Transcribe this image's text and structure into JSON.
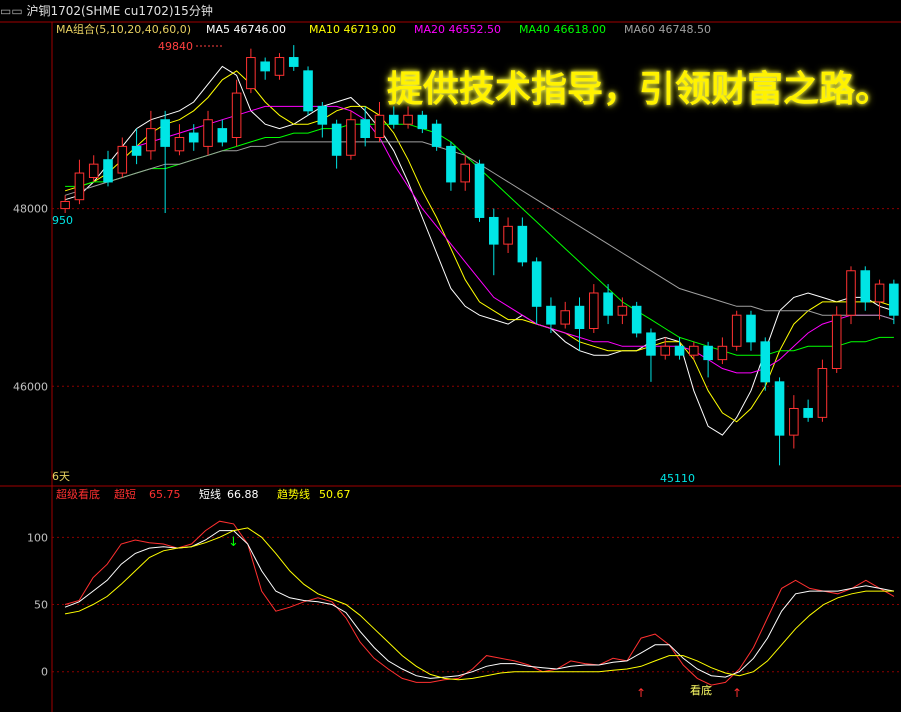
{
  "header": {
    "title": "沪铜1702(SHME  cu1702)15分钟",
    "ma_legend": [
      {
        "label": "MA组合(5,10,20,40,60,0)",
        "color": "#e8d060"
      },
      {
        "label": "MA5  46746.00",
        "color": "#ffffff"
      },
      {
        "label": "MA10  46719.00",
        "color": "#ffff00"
      },
      {
        "label": "MA20  46552.50",
        "color": "#ff00ff"
      },
      {
        "label": "MA40  46618.00",
        "color": "#00ff00"
      },
      {
        "label": "MA60  46748.50",
        "color": "#a0a0a0"
      }
    ]
  },
  "slogan": "提供技术指导，引领财富之路。",
  "price_axis": {
    "ticks": [
      "48000",
      "46000"
    ]
  },
  "price_annotations": {
    "high": "49840",
    "low": "45110",
    "left_price": "950",
    "left_days": "6天"
  },
  "indicator": {
    "legend": [
      {
        "label": "超级看底",
        "color": "#ff3030"
      },
      {
        "label": "超短",
        "color": "#ff3030"
      },
      {
        "label": "65.75",
        "color": "#ff3030"
      },
      {
        "label": "短线",
        "color": "#ffffff"
      },
      {
        "label": "66.88",
        "color": "#ffffff"
      },
      {
        "label": "趋势线",
        "color": "#ffff00"
      },
      {
        "label": "50.67",
        "color": "#ffff00"
      }
    ],
    "axis_ticks": [
      "100",
      "50",
      "0"
    ],
    "signal_label": "看底"
  },
  "chart_data": [
    {
      "type": "line",
      "title": "沪铜1702 15分钟",
      "ylim": [
        44900,
        50100
      ],
      "series": [
        {
          "name": "MA5",
          "color": "#ffffff",
          "values": [
            48100,
            48150,
            48300,
            48500,
            48700,
            48900,
            49000,
            49050,
            49100,
            49200,
            49400,
            49600,
            49500,
            49100,
            48950,
            48900,
            48950,
            49050,
            49150,
            49200,
            49250,
            49100,
            48900,
            48650,
            48300,
            47900,
            47500,
            47100,
            46900,
            46800,
            46750,
            46700,
            46800,
            46700,
            46650,
            46500,
            46400,
            46350,
            46350,
            46400,
            46400,
            46500,
            46550,
            46500,
            45950,
            45550,
            45450,
            45650,
            45950,
            46400,
            46850,
            47000,
            47050,
            47000,
            46950,
            47000,
            47000,
            46900,
            46850
          ]
        },
        {
          "name": "MA10",
          "color": "#ffff00",
          "values": [
            48200,
            48250,
            48300,
            48400,
            48550,
            48700,
            48850,
            48950,
            49000,
            49100,
            49250,
            49450,
            49550,
            49400,
            49200,
            49050,
            48950,
            48950,
            49000,
            49100,
            49150,
            49150,
            49050,
            48850,
            48550,
            48200,
            47900,
            47550,
            47200,
            46950,
            46850,
            46750,
            46750,
            46700,
            46650,
            46600,
            46500,
            46450,
            46400,
            46400,
            46400,
            46450,
            46500,
            46500,
            46300,
            45950,
            45700,
            45600,
            45750,
            46000,
            46400,
            46700,
            46850,
            46950,
            46950,
            46950,
            46950,
            46950,
            46900
          ]
        },
        {
          "name": "MA20",
          "color": "#ff00ff",
          "values": [
            null,
            null,
            null,
            null,
            null,
            48700,
            48750,
            48800,
            48850,
            48900,
            48950,
            49000,
            49050,
            49100,
            49150,
            49150,
            49150,
            49150,
            49150,
            49150,
            49100,
            49000,
            48800,
            48500,
            48250,
            48000,
            47800,
            47600,
            47400,
            47200,
            47000,
            46900,
            46800,
            46700,
            46650,
            46600,
            46550,
            46500,
            46500,
            46450,
            46450,
            46450,
            46450,
            46450,
            46400,
            46300,
            46200,
            46150,
            46150,
            46200,
            46300,
            46450,
            46600,
            46700,
            46750,
            46800,
            46800,
            46800,
            46750
          ]
        },
        {
          "name": "MA40",
          "color": "#00ff00",
          "values": [
            48250,
            48250,
            48300,
            48300,
            48350,
            48400,
            48450,
            48450,
            48500,
            48550,
            48600,
            48650,
            48700,
            48750,
            48800,
            48800,
            48850,
            48850,
            48900,
            48900,
            48950,
            48950,
            48950,
            48950,
            48950,
            48900,
            48850,
            48750,
            48600,
            48450,
            48300,
            48150,
            48000,
            47850,
            47700,
            47550,
            47400,
            47250,
            47100,
            46950,
            46850,
            46750,
            46650,
            46550,
            46500,
            46450,
            46400,
            46350,
            46350,
            46350,
            46400,
            46400,
            46450,
            46450,
            46450,
            46500,
            46500,
            46550,
            46550
          ]
        },
        {
          "name": "MA60",
          "color": "#a0a0a0",
          "values": [
            48150,
            48200,
            48250,
            48300,
            48350,
            48400,
            48450,
            48500,
            48500,
            48550,
            48600,
            48650,
            48650,
            48700,
            48700,
            48750,
            48750,
            48750,
            48750,
            48750,
            48750,
            48750,
            48750,
            48750,
            48750,
            48750,
            48700,
            48650,
            48600,
            48500,
            48400,
            48300,
            48200,
            48100,
            48000,
            47900,
            47800,
            47700,
            47600,
            47500,
            47400,
            47300,
            47200,
            47100,
            47050,
            47000,
            46950,
            46900,
            46900,
            46850,
            46850,
            46850,
            46850,
            46800,
            46800,
            46800,
            46800,
            46800,
            46750
          ]
        }
      ],
      "candles": [
        {
          "o": 48000,
          "c": 48080,
          "h": 48150,
          "l": 47950
        },
        {
          "o": 48100,
          "c": 48400,
          "h": 48550,
          "l": 48050
        },
        {
          "o": 48350,
          "c": 48500,
          "h": 48600,
          "l": 48300
        },
        {
          "o": 48550,
          "c": 48300,
          "h": 48650,
          "l": 48250
        },
        {
          "o": 48400,
          "c": 48700,
          "h": 48800,
          "l": 48350
        },
        {
          "o": 48700,
          "c": 48600,
          "h": 48900,
          "l": 48500
        },
        {
          "o": 48650,
          "c": 48900,
          "h": 49100,
          "l": 48550
        },
        {
          "o": 49000,
          "c": 48700,
          "h": 49100,
          "l": 47950
        },
        {
          "o": 48650,
          "c": 48800,
          "h": 48950,
          "l": 48600
        },
        {
          "o": 48850,
          "c": 48750,
          "h": 48950,
          "l": 48650
        },
        {
          "o": 48700,
          "c": 49000,
          "h": 49100,
          "l": 48600
        },
        {
          "o": 48900,
          "c": 48750,
          "h": 49000,
          "l": 48700
        },
        {
          "o": 48800,
          "c": 49300,
          "h": 49450,
          "l": 48700
        },
        {
          "o": 49350,
          "c": 49700,
          "h": 49800,
          "l": 49300
        },
        {
          "o": 49650,
          "c": 49550,
          "h": 49700,
          "l": 49450
        },
        {
          "o": 49500,
          "c": 49700,
          "h": 49750,
          "l": 49450
        },
        {
          "o": 49700,
          "c": 49600,
          "h": 49840,
          "l": 49550
        },
        {
          "o": 49550,
          "c": 49100,
          "h": 49600,
          "l": 49050
        },
        {
          "o": 49150,
          "c": 48950,
          "h": 49200,
          "l": 48800
        },
        {
          "o": 48950,
          "c": 48600,
          "h": 49000,
          "l": 48450
        },
        {
          "o": 48600,
          "c": 49000,
          "h": 49100,
          "l": 48550
        },
        {
          "o": 49000,
          "c": 48800,
          "h": 49150,
          "l": 48700
        },
        {
          "o": 48800,
          "c": 49050,
          "h": 49200,
          "l": 48750
        },
        {
          "o": 49050,
          "c": 48950,
          "h": 49150,
          "l": 48900
        },
        {
          "o": 48950,
          "c": 49050,
          "h": 49150,
          "l": 48900
        },
        {
          "o": 49050,
          "c": 48900,
          "h": 49100,
          "l": 48850
        },
        {
          "o": 48950,
          "c": 48700,
          "h": 49000,
          "l": 48650
        },
        {
          "o": 48700,
          "c": 48300,
          "h": 48750,
          "l": 48200
        },
        {
          "o": 48300,
          "c": 48500,
          "h": 48600,
          "l": 48200
        },
        {
          "o": 48500,
          "c": 47900,
          "h": 48550,
          "l": 47850
        },
        {
          "o": 47900,
          "c": 47600,
          "h": 48000,
          "l": 47250
        },
        {
          "o": 47600,
          "c": 47800,
          "h": 47900,
          "l": 47500
        },
        {
          "o": 47800,
          "c": 47400,
          "h": 47900,
          "l": 47350
        },
        {
          "o": 47400,
          "c": 46900,
          "h": 47450,
          "l": 46700
        },
        {
          "o": 46900,
          "c": 46700,
          "h": 47000,
          "l": 46600
        },
        {
          "o": 46700,
          "c": 46850,
          "h": 46950,
          "l": 46650
        },
        {
          "o": 46900,
          "c": 46650,
          "h": 47000,
          "l": 46400
        },
        {
          "o": 46650,
          "c": 47050,
          "h": 47150,
          "l": 46600
        },
        {
          "o": 47050,
          "c": 46800,
          "h": 47150,
          "l": 46700
        },
        {
          "o": 46800,
          "c": 46900,
          "h": 47000,
          "l": 46700
        },
        {
          "o": 46900,
          "c": 46600,
          "h": 46950,
          "l": 46550
        },
        {
          "o": 46600,
          "c": 46350,
          "h": 46650,
          "l": 46050
        },
        {
          "o": 46350,
          "c": 46450,
          "h": 46550,
          "l": 46300
        },
        {
          "o": 46450,
          "c": 46350,
          "h": 46550,
          "l": 46300
        },
        {
          "o": 46350,
          "c": 46450,
          "h": 46500,
          "l": 46300
        },
        {
          "o": 46450,
          "c": 46300,
          "h": 46500,
          "l": 46100
        },
        {
          "o": 46300,
          "c": 46450,
          "h": 46550,
          "l": 46250
        },
        {
          "o": 46450,
          "c": 46800,
          "h": 46850,
          "l": 46400
        },
        {
          "o": 46800,
          "c": 46500,
          "h": 46850,
          "l": 46400
        },
        {
          "o": 46500,
          "c": 46050,
          "h": 46550,
          "l": 45950
        },
        {
          "o": 46050,
          "c": 45450,
          "h": 46100,
          "l": 45110
        },
        {
          "o": 45450,
          "c": 45750,
          "h": 45900,
          "l": 45300
        },
        {
          "o": 45750,
          "c": 45650,
          "h": 45850,
          "l": 45600
        },
        {
          "o": 45650,
          "c": 46200,
          "h": 46300,
          "l": 45600
        },
        {
          "o": 46200,
          "c": 46800,
          "h": 46900,
          "l": 46150
        },
        {
          "o": 46800,
          "c": 47300,
          "h": 47350,
          "l": 46700
        },
        {
          "o": 47300,
          "c": 46950,
          "h": 47350,
          "l": 46850
        },
        {
          "o": 46950,
          "c": 47150,
          "h": 47200,
          "l": 46750
        },
        {
          "o": 47150,
          "c": 46800,
          "h": 47200,
          "l": 46700
        }
      ]
    },
    {
      "type": "line",
      "title": "超级看底",
      "ylim": [
        -30,
        130
      ],
      "series": [
        {
          "name": "超短",
          "color": "#ff3030",
          "values": [
            50,
            53,
            70,
            80,
            95,
            98,
            96,
            95,
            92,
            95,
            105,
            112,
            110,
            95,
            60,
            45,
            48,
            52,
            55,
            52,
            40,
            22,
            10,
            2,
            -5,
            -8,
            -8,
            -6,
            -5,
            2,
            12,
            10,
            8,
            5,
            0,
            2,
            8,
            6,
            5,
            10,
            8,
            25,
            28,
            20,
            5,
            -5,
            -10,
            -8,
            2,
            18,
            40,
            62,
            68,
            62,
            60,
            58,
            62,
            68,
            62,
            56
          ]
        },
        {
          "name": "短线",
          "color": "#ffffff",
          "values": [
            48,
            52,
            60,
            68,
            80,
            88,
            92,
            93,
            92,
            93,
            98,
            105,
            105,
            95,
            75,
            60,
            55,
            53,
            52,
            50,
            44,
            30,
            18,
            8,
            2,
            -3,
            -5,
            -4,
            -3,
            0,
            4,
            6,
            6,
            4,
            3,
            2,
            4,
            5,
            5,
            7,
            8,
            14,
            20,
            20,
            10,
            2,
            -3,
            -4,
            0,
            10,
            25,
            45,
            58,
            60,
            60,
            60,
            62,
            64,
            62,
            60
          ]
        },
        {
          "name": "趋势线",
          "color": "#ffff00",
          "values": [
            43,
            45,
            50,
            56,
            65,
            75,
            85,
            90,
            92,
            93,
            96,
            100,
            105,
            107,
            100,
            88,
            75,
            65,
            58,
            54,
            50,
            42,
            32,
            22,
            12,
            4,
            -2,
            -5,
            -6,
            -5,
            -3,
            -1,
            0,
            0,
            0,
            0,
            0,
            0,
            0,
            1,
            2,
            4,
            8,
            12,
            12,
            8,
            3,
            -1,
            -3,
            0,
            8,
            20,
            32,
            42,
            50,
            55,
            58,
            60,
            60,
            60
          ]
        }
      ]
    }
  ]
}
